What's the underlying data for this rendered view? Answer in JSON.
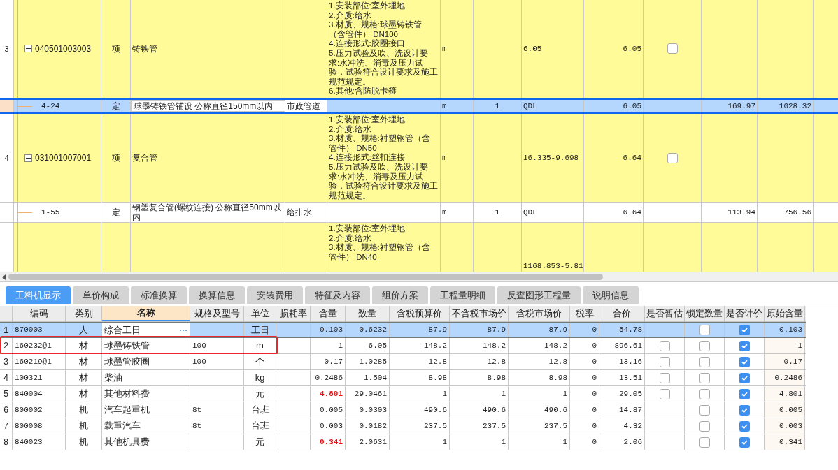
{
  "upper_grid": {
    "rows": [
      {
        "kind": "item",
        "number": "3",
        "expanded": true,
        "code": "040501003003",
        "type": "项",
        "name": "铸铁管",
        "feature_lines": [
          "1.安装部位:室外埋地",
          "2.介质:给水",
          "3.材质、规格:球墨铸铁管",
          "（含管件） DN100",
          "4.连接形式:胶圈接口",
          "5.压力试验及吹、洗设计要",
          "求:水冲洗、消毒及压力试",
          "验，试验符合设计要求及施工",
          "规范规定。",
          "6.其他:含防脱卡箍"
        ],
        "unit": "m",
        "expression": "6.05",
        "quantity": "6.05",
        "estimate_checked": false,
        "selected": false,
        "clipped": false
      },
      {
        "kind": "sub",
        "code": "4-24",
        "type": "定",
        "name": "球墨铸铁管铺设 公称直径150mm以内",
        "specialty": "市政管道",
        "unit": "m",
        "coefficient": "1",
        "expression": "QDL",
        "quantity": "6.05",
        "unit_price": "169.97",
        "total": "1028.32",
        "selected": true
      },
      {
        "kind": "item",
        "number": "4",
        "expanded": true,
        "code": "031001007001",
        "type": "项",
        "name": "复合管",
        "feature_lines": [
          "1.安装部位:室外埋地",
          "2.介质:给水",
          "3.材质、规格:衬塑钢管（含",
          "管件） DN50",
          "4.连接形式:丝扣连接",
          "5.压力试验及吹、洗设计要",
          "求:水冲洗、消毒及压力试",
          "验，试验符合设计要求及施工",
          "规范规定。"
        ],
        "unit": "m",
        "expression": "16.335-9.698",
        "quantity": "6.64",
        "estimate_checked": false,
        "selected": false,
        "clipped": false
      },
      {
        "kind": "sub",
        "code": "1-55",
        "type": "定",
        "name": "钢塑复合管(螺纹连接) 公称直径50mm以内",
        "specialty": "给排水",
        "unit": "m",
        "coefficient": "1",
        "expression": "QDL",
        "quantity": "6.64",
        "unit_price": "113.94",
        "total": "756.56",
        "selected": false
      },
      {
        "kind": "item",
        "feature_lines": [
          "1.安装部位:室外埋地",
          "2.介质:给水",
          "3.材质、规格:衬塑钢管（含",
          "管件） DN40"
        ],
        "expression": "1168.853-5.81",
        "selected": false,
        "clipped": true
      }
    ]
  },
  "tabs": [
    {
      "label": "工料机显示",
      "selected": true
    },
    {
      "label": "单价构成",
      "selected": false
    },
    {
      "label": "标准换算",
      "selected": false
    },
    {
      "label": "换算信息",
      "selected": false
    },
    {
      "label": "安装费用",
      "selected": false
    },
    {
      "label": "特征及内容",
      "selected": false
    },
    {
      "label": "组价方案",
      "selected": false
    },
    {
      "label": "工程量明细",
      "selected": false
    },
    {
      "label": "反查图形工程量",
      "selected": false
    },
    {
      "label": "说明信息",
      "selected": false
    }
  ],
  "resource_table": {
    "columns": [
      {
        "label": "编码",
        "sorted": false
      },
      {
        "label": "类别",
        "sorted": false
      },
      {
        "label": "名称",
        "sorted": true
      },
      {
        "label": "规格及型号",
        "sorted": false
      },
      {
        "label": "单位",
        "sorted": false
      },
      {
        "label": "损耗率",
        "sorted": false
      },
      {
        "label": "含量",
        "sorted": false
      },
      {
        "label": "数量",
        "sorted": false
      },
      {
        "label": "含税预算价",
        "sorted": false
      },
      {
        "label": "不含税市场价",
        "sorted": false
      },
      {
        "label": "含税市场价",
        "sorted": false
      },
      {
        "label": "税率",
        "sorted": false
      },
      {
        "label": "合价",
        "sorted": false
      },
      {
        "label": "是否暂估",
        "sorted": false
      },
      {
        "label": "锁定数量",
        "sorted": false
      },
      {
        "label": "是否计价",
        "sorted": false
      },
      {
        "label": "原始含量",
        "sorted": false
      }
    ],
    "rows": [
      {
        "number": "1",
        "code": "870003",
        "category": "人",
        "name": "综合工日",
        "unit": "工日",
        "content": "0.103",
        "content_highlight": false,
        "quantity": "0.6232",
        "tax_budget_price": "87.9",
        "ex_tax_market_price": "87.9",
        "tax_market_price": "87.9",
        "tax_rate": "0",
        "total": "54.78",
        "lock_quantity": false,
        "priced": true,
        "original_content": "0.103",
        "selected": true,
        "outlined": false
      },
      {
        "number": "2",
        "code": "160232@1",
        "category": "材",
        "name": "球墨铸铁管",
        "spec": "100",
        "unit": "m",
        "content": "1",
        "content_highlight": false,
        "quantity": "6.05",
        "tax_budget_price": "148.2",
        "ex_tax_market_price": "148.2",
        "tax_market_price": "148.2",
        "tax_rate": "0",
        "total": "896.61",
        "provisional": false,
        "lock_quantity": false,
        "priced": true,
        "original_content": "1",
        "selected": false,
        "outlined": true
      },
      {
        "number": "3",
        "code": "160219@1",
        "category": "材",
        "name": "球墨管胶圈",
        "spec": "100",
        "unit": "个",
        "content": "0.17",
        "content_highlight": false,
        "quantity": "1.0285",
        "tax_budget_price": "12.8",
        "ex_tax_market_price": "12.8",
        "tax_market_price": "12.8",
        "tax_rate": "0",
        "total": "13.16",
        "provisional": false,
        "lock_quantity": false,
        "priced": true,
        "original_content": "0.17",
        "selected": false,
        "outlined": false
      },
      {
        "number": "4",
        "code": "100321",
        "category": "材",
        "name": "柴油",
        "unit": "kg",
        "content": "0.2486",
        "content_highlight": false,
        "quantity": "1.504",
        "tax_budget_price": "8.98",
        "ex_tax_market_price": "8.98",
        "tax_market_price": "8.98",
        "tax_rate": "0",
        "total": "13.51",
        "provisional": false,
        "lock_quantity": false,
        "priced": true,
        "original_content": "0.2486",
        "selected": false,
        "outlined": false
      },
      {
        "number": "5",
        "code": "840004",
        "category": "材",
        "name": "其他材料费",
        "unit": "元",
        "content": "4.801",
        "content_highlight": true,
        "quantity": "29.0461",
        "tax_budget_price": "1",
        "ex_tax_market_price": "1",
        "tax_market_price": "1",
        "tax_rate": "0",
        "total": "29.05",
        "provisional": false,
        "lock_quantity": false,
        "priced": true,
        "original_content": "4.801",
        "selected": false,
        "outlined": false
      },
      {
        "number": "6",
        "code": "800002",
        "category": "机",
        "name": "汽车起重机",
        "spec": "8t",
        "unit": "台班",
        "content": "0.005",
        "content_highlight": false,
        "quantity": "0.0303",
        "tax_budget_price": "490.6",
        "ex_tax_market_price": "490.6",
        "tax_market_price": "490.6",
        "tax_rate": "0",
        "total": "14.87",
        "lock_quantity": false,
        "priced": true,
        "original_content": "0.005",
        "selected": false,
        "outlined": false
      },
      {
        "number": "7",
        "code": "800008",
        "category": "机",
        "name": "载重汽车",
        "spec": "8t",
        "unit": "台班",
        "content": "0.003",
        "content_highlight": false,
        "quantity": "0.0182",
        "tax_budget_price": "237.5",
        "ex_tax_market_price": "237.5",
        "tax_market_price": "237.5",
        "tax_rate": "0",
        "total": "4.32",
        "lock_quantity": false,
        "priced": true,
        "original_content": "0.003",
        "selected": false,
        "outlined": false
      },
      {
        "number": "8",
        "code": "840023",
        "category": "机",
        "name": "其他机具费",
        "unit": "元",
        "content": "0.341",
        "content_highlight": true,
        "quantity": "2.0631",
        "tax_budget_price": "1",
        "ex_tax_market_price": "1",
        "tax_market_price": "1",
        "tax_rate": "0",
        "total": "2.06",
        "lock_quantity": false,
        "priced": true,
        "original_content": "0.341",
        "selected": false,
        "outlined": false
      }
    ]
  }
}
